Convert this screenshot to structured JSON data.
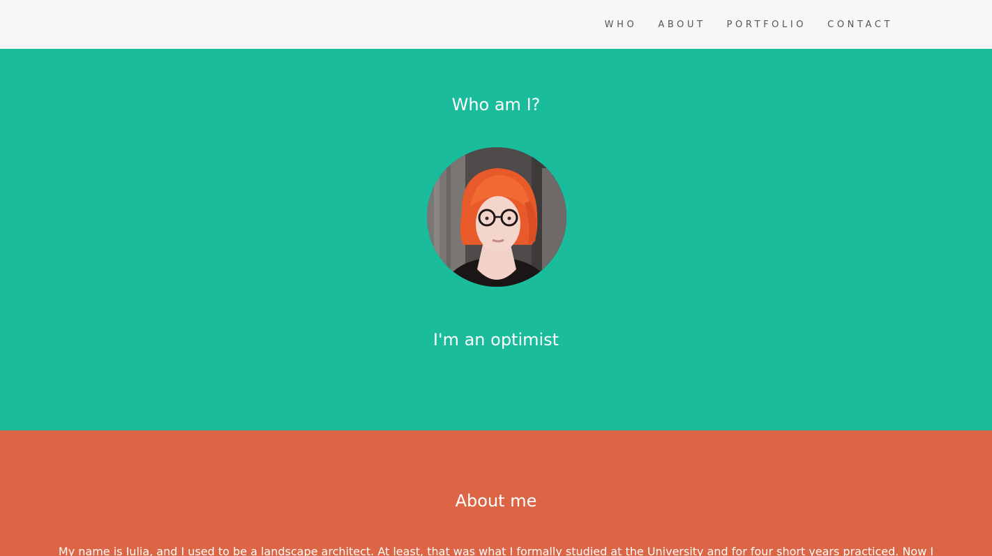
{
  "nav": {
    "items": [
      {
        "label": "WHO"
      },
      {
        "label": "ABOUT"
      },
      {
        "label": "PORTFOLIO"
      },
      {
        "label": "CONTACT"
      }
    ]
  },
  "who": {
    "title": "Who am I?",
    "tagline": "I'm an optimist",
    "avatar_icon": "profile-photo"
  },
  "about": {
    "title": "About me",
    "text": "My name is Iulia, and I used to be a landscape architect. At least, that was what I formally studied at the University and for four short years practiced. Now I"
  },
  "colors": {
    "nav_bg": "#f7f7f7",
    "who_bg": "#1abc9c",
    "about_bg": "#dc6545",
    "text_light": "#ffffff",
    "nav_text": "#555555"
  }
}
